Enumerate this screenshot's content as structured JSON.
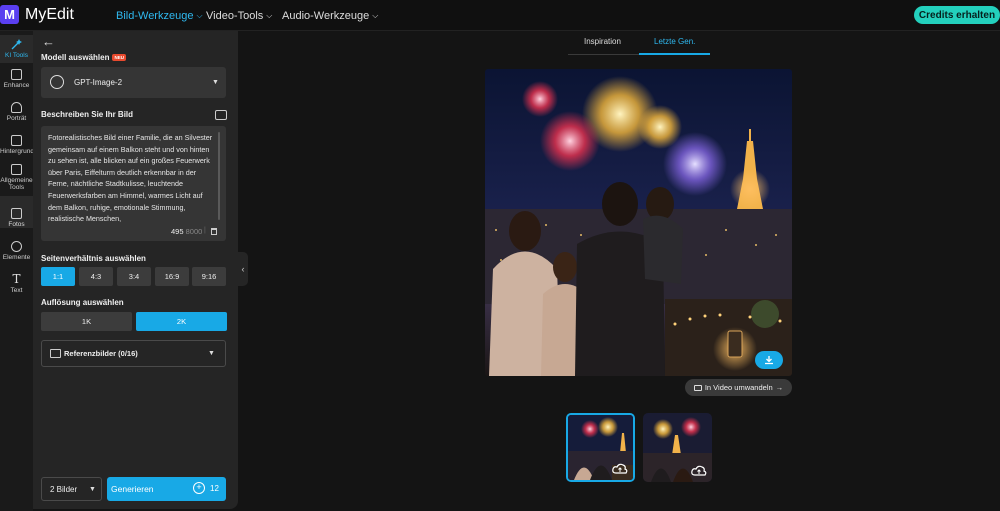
{
  "app": {
    "name": "MyEdit",
    "logo_letter": "M"
  },
  "nav": [
    {
      "label": "Bild-Werkzeuge",
      "active": true
    },
    {
      "label": "Video-Tools",
      "active": false
    },
    {
      "label": "Audio-Werkzeuge",
      "active": false
    }
  ],
  "credits_button": "Credits erhalten",
  "rail": [
    {
      "label": "KI Tools",
      "icon": "magic-wand-icon",
      "active": true
    },
    {
      "label": "Enhance",
      "icon": "image-icon"
    },
    {
      "label": "Porträt",
      "icon": "portrait-icon"
    },
    {
      "label": "Hintergrund",
      "icon": "background-icon"
    },
    {
      "label": "Allgemeine Tools",
      "icon": "tools-icon"
    },
    {
      "label": "Fotos",
      "icon": "photo-icon"
    },
    {
      "label": "Elemente",
      "icon": "elements-icon"
    },
    {
      "label": "Text",
      "icon": "text-icon",
      "glyph": "T"
    }
  ],
  "panel": {
    "model_label": "Modell auswählen",
    "new_badge": "NEU",
    "model_value": "GPT-Image-2",
    "describe_label": "Beschreiben Sie Ihr Bild",
    "prompt": "Fotorealistisches Bild einer Familie, die an Silvester gemeinsam auf einem Balkon steht und von hinten zu sehen ist, alle blicken auf ein großes Feuerwerk über Paris, Eiffelturm deutlich erkennbar in der Ferne, nächtliche Stadtkulisse, leuchtende Feuerwerksfarben am Himmel, warmes Licht auf dem Balkon, ruhige, emotionale Stimmung, realistische Menschen,",
    "char_count": "495",
    "char_max": "8000",
    "char_sep": "|",
    "ratio_label": "Seitenverhältnis auswählen",
    "ratios": [
      "1:1",
      "4:3",
      "3:4",
      "16:9",
      "9:16"
    ],
    "ratio_selected": "1:1",
    "resolution_label": "Auflösung auswählen",
    "resolutions": [
      "1K",
      "2K"
    ],
    "resolution_selected": "2K",
    "reference_label": "Referenzbilder (0/16)",
    "image_count": "2 Bilder",
    "generate_label": "Generieren",
    "generate_cost": "12"
  },
  "tabs": [
    {
      "label": "Inspiration",
      "active": false
    },
    {
      "label": "Letzte Gen.",
      "active": true
    }
  ],
  "result": {
    "video_button": "In Video umwandeln",
    "video_arrow": "→"
  },
  "colors": {
    "accent": "#18a9e6",
    "active_nav": "#2fb9f0",
    "credits": "#23d0bd",
    "logo": "#5a3ff0",
    "panel_bg": "#252525",
    "app_bg": "#141414"
  }
}
